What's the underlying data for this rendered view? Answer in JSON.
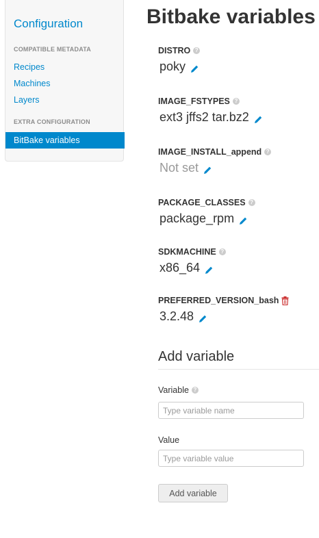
{
  "sidebar": {
    "title": "Configuration",
    "compatible_header": "COMPATIBLE METADATA",
    "links": [
      "Recipes",
      "Machines",
      "Layers"
    ],
    "extra_header": "EXTRA CONFIGURATION",
    "active_item": "BitBake variables"
  },
  "page": {
    "title": "Bitbake variables"
  },
  "variables": [
    {
      "name": "DISTRO",
      "value": "poky",
      "icon": "help-icon"
    },
    {
      "name": "IMAGE_FSTYPES",
      "value": "ext3 jffs2 tar.bz2",
      "icon": "help-icon"
    },
    {
      "name": "IMAGE_INSTALL_append",
      "value": "Not set",
      "icon": "help-icon"
    },
    {
      "name": "PACKAGE_CLASSES",
      "value": "package_rpm",
      "icon": "help-icon"
    },
    {
      "name": "SDKMACHINE",
      "value": "x86_64",
      "icon": "help-icon"
    },
    {
      "name": "PREFERRED_VERSION_bash",
      "value": "3.2.48",
      "icon": "trash-icon"
    }
  ],
  "add_form": {
    "title": "Add variable",
    "variable_label": "Variable",
    "variable_placeholder": "Type variable name",
    "value_label": "Value",
    "value_placeholder": "Type variable value",
    "button_label": "Add variable"
  },
  "colors": {
    "accent": "#0088cc",
    "edit_icon": "#0088cc",
    "delete_icon": "#cc3333",
    "muted": "#999999"
  }
}
